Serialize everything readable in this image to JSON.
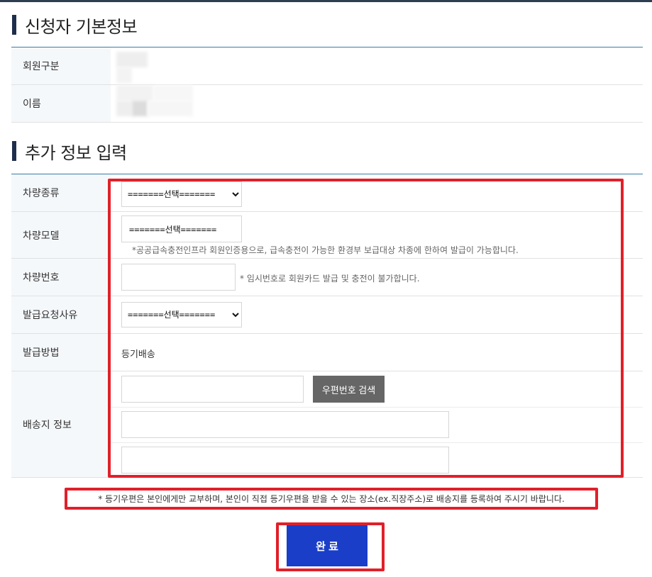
{
  "basic_info": {
    "title": "신청자 기본정보",
    "rows": [
      {
        "label": "회원구분"
      },
      {
        "label": "이름"
      }
    ]
  },
  "extra_info": {
    "title": "추가 정보 입력",
    "vehicle_type": {
      "label": "차량종류",
      "selected": "=======선택======="
    },
    "vehicle_model": {
      "label": "차량모델",
      "value": "=======선택=======",
      "note": "*공공급속충전인프라 회원인증용으로, 급속충전이 가능한 환경부 보급대상 차종에 한하여 발급이 가능합니다."
    },
    "vehicle_number": {
      "label": "차량번호",
      "value": "",
      "note": "* 임시번호로 회원카드 발급 및 충전이 불가합니다."
    },
    "issue_reason": {
      "label": "발급요청사유",
      "selected": "=======선택======="
    },
    "issue_method": {
      "label": "발급방법",
      "value": "등기배송"
    },
    "delivery": {
      "label": "배송지 정보",
      "zip_button": "우편번호 검색",
      "zip": "",
      "address1": "",
      "address2": ""
    }
  },
  "notice": "* 등기우편은 본인에게만 교부하며, 본인이 직접 등기우편을 받을 수 있는 장소(ex.직장주소)로 배송지를 등록하여 주시기 바랍니다.",
  "submit_label": "완 료",
  "colors": {
    "accent": "#1a3ec8",
    "highlight": "#e0202a",
    "table_border": "#3a7ca8"
  }
}
